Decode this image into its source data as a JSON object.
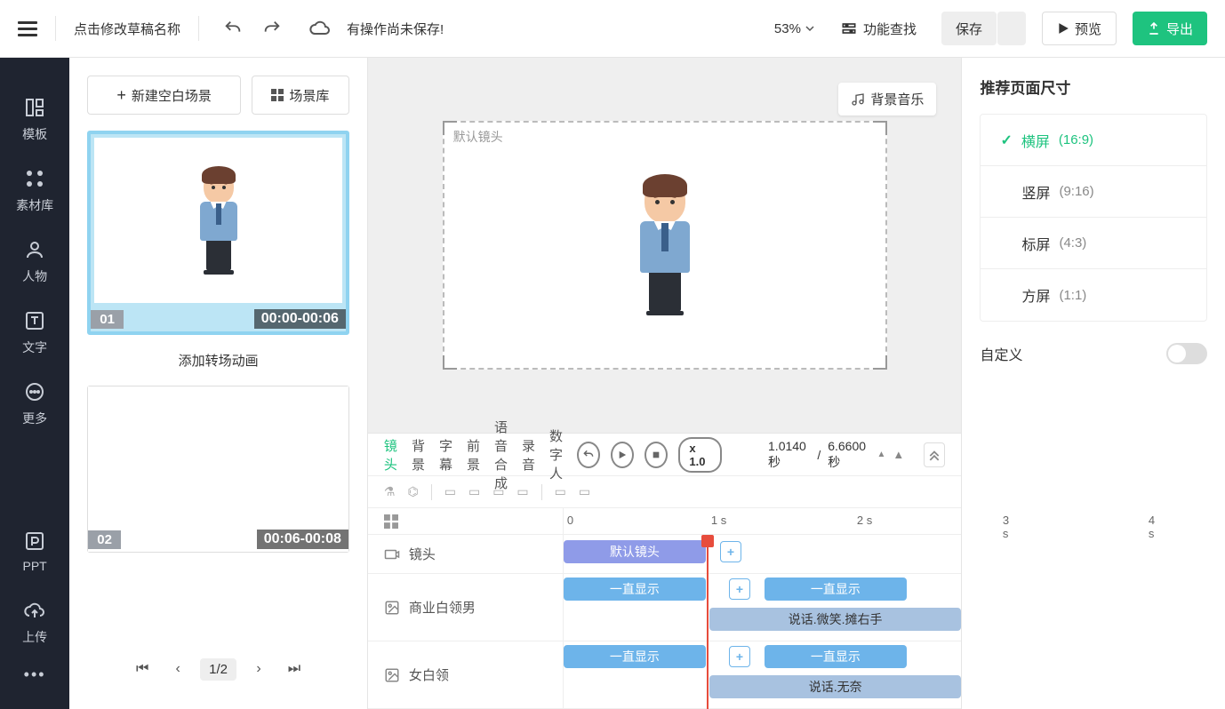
{
  "top": {
    "title": "点击修改草稿名称",
    "unsaved": "有操作尚未保存!",
    "zoom": "53%",
    "find": "功能查找",
    "save": "保存",
    "preview": "预览",
    "export": "导出"
  },
  "side": {
    "template": "模板",
    "library": "素材库",
    "character": "人物",
    "text": "文字",
    "more": "更多",
    "ppt": "PPT",
    "upload": "上传"
  },
  "scenes": {
    "new_blank": "新建空白场景",
    "library": "场景库",
    "transition": "添加转场动画",
    "items": [
      {
        "num": "01",
        "time": "00:00-00:06"
      },
      {
        "num": "02",
        "time": "00:06-00:08"
      }
    ],
    "page": "1/2"
  },
  "canvas": {
    "bgm": "背景音乐",
    "label": "默认镜头"
  },
  "timeline": {
    "tabs": [
      "镜头",
      "背景",
      "字幕",
      "前景",
      "语音合成",
      "录音",
      "数字人"
    ],
    "speed": "x 1.0",
    "current": "1.0140 秒",
    "total": "6.6600 秒",
    "tracks": {
      "shot": "镜头",
      "char1": "商业白领男",
      "char2": "女白领"
    },
    "clips": {
      "default_shot": "默认镜头",
      "always_show": "一直显示",
      "talk_smile": "说话.微笑.摊右手",
      "talk_helpless": "说话.无奈"
    },
    "marks": [
      "0",
      "1 s",
      "2 s",
      "3 s",
      "4 s"
    ]
  },
  "right": {
    "title": "推荐页面尺寸",
    "ratios": [
      {
        "name": "横屏",
        "value": "(16:9)"
      },
      {
        "name": "竖屏",
        "value": "(9:16)"
      },
      {
        "name": "标屏",
        "value": "(4:3)"
      },
      {
        "name": "方屏",
        "value": "(1:1)"
      }
    ],
    "custom": "自定义"
  }
}
